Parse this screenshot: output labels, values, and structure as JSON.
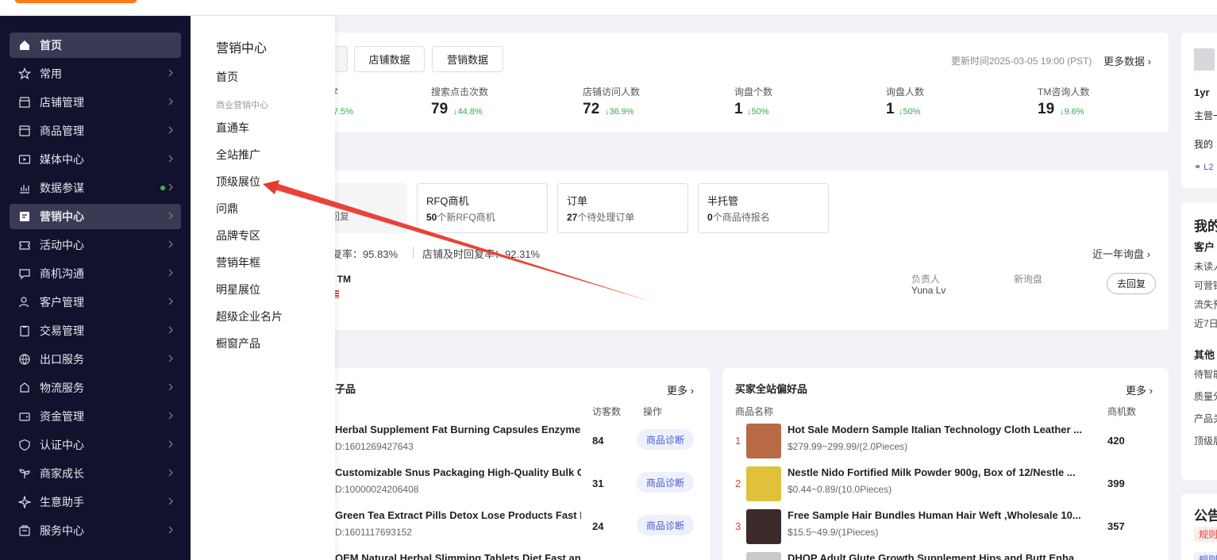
{
  "nav": [
    {
      "label": "首页",
      "icon": "home-icon"
    },
    {
      "label": "常用",
      "icon": "star-icon"
    },
    {
      "label": "店铺管理",
      "icon": "store-icon"
    },
    {
      "label": "商品管理",
      "icon": "box-icon"
    },
    {
      "label": "媒体中心",
      "icon": "video-icon"
    },
    {
      "label": "数据参谋",
      "icon": "chart-icon"
    },
    {
      "label": "营销中心",
      "icon": "marketing-icon"
    },
    {
      "label": "活动中心",
      "icon": "ticket-icon"
    },
    {
      "label": "商机沟通",
      "icon": "message-icon"
    },
    {
      "label": "客户管理",
      "icon": "users-icon"
    },
    {
      "label": "交易管理",
      "icon": "clipboard-icon"
    },
    {
      "label": "出口服务",
      "icon": "globe-icon"
    },
    {
      "label": "物流服务",
      "icon": "truck-icon"
    },
    {
      "label": "资金管理",
      "icon": "wallet-icon"
    },
    {
      "label": "认证中心",
      "icon": "shield-icon"
    },
    {
      "label": "商家成长",
      "icon": "sprout-icon"
    },
    {
      "label": "生意助手",
      "icon": "sparkle-icon"
    },
    {
      "label": "服务中心",
      "icon": "service-icon"
    }
  ],
  "flyout": {
    "title": "营销中心",
    "home": "首页",
    "section": "商业营销中心",
    "items": [
      "直通车",
      "全站推广",
      "顶级展位",
      "问鼎",
      "品牌专区",
      "营销年框",
      "明星展位",
      "超级企业名片",
      "橱窗产品"
    ]
  },
  "stats_card": {
    "tabs": [
      "店铺数据",
      "营销数据"
    ],
    "updated": "更新时间2025-03-05 19:00 (PST)",
    "more": "更多数据",
    "partial_change": "7.5%",
    "stats": [
      {
        "label": "搜索点击次数",
        "value": "79",
        "change": "↓44.8%"
      },
      {
        "label": "店铺访问人数",
        "value": "72",
        "change": "↓36.9%"
      },
      {
        "label": "询盘个数",
        "value": "1",
        "change": "↓50%"
      },
      {
        "label": "询盘人数",
        "value": "1",
        "change": "↓50%"
      },
      {
        "label": "TM咨询人数",
        "value": "19",
        "change": "↓9.6%"
      }
    ]
  },
  "inquiry_card": {
    "partial_box_text": "回复",
    "boxes": [
      {
        "title": "RFQ商机",
        "count": "50",
        "text": "个新RFQ商机"
      },
      {
        "title": "订单",
        "count": "27",
        "text": "个待处理订单"
      },
      {
        "title": "半托管",
        "count": "0",
        "text": "个商品待报名"
      }
    ],
    "rate1": "复率：95.83%",
    "rate2": "店铺及时回复率：92.31%",
    "year_link": "近一年询盘",
    "tm_label": "TM",
    "owner_label": "负责人",
    "owner_name": "Yuna Lv",
    "new_inquiry": "新询盘",
    "reply_button": "去回复"
  },
  "left_products": {
    "title": "子品",
    "more": "更多",
    "col_visitors": "访客数",
    "col_action": "操作",
    "rows": [
      {
        "title": "Herbal Supplement Fat Burning Capsules Enzyme ...",
        "id": "D:1601269427643",
        "visitors": "84",
        "action": "商品诊断"
      },
      {
        "title": "Customizable Snus Packaging High-Quality Bulk Or...",
        "id": "D:10000024206408",
        "visitors": "31",
        "action": "商品诊断"
      },
      {
        "title": "Green Tea Extract Pills Detox Lose Products Fast B...",
        "id": "D:1601117693152",
        "visitors": "24",
        "action": "商品诊断"
      },
      {
        "title": "OEM Natural Herbal Slimming Tablets Diet Fast an...",
        "id": "",
        "visitors": "",
        "action": ""
      }
    ]
  },
  "right_products": {
    "title": "买家全站偏好品",
    "more": "更多",
    "col_name": "商品名称",
    "col_count": "商机数",
    "rows": [
      {
        "rank": "1",
        "title": "Hot Sale Modern Sample Italian Technology Cloth Leather ...",
        "price": "$279.99~299.99/(2.0Pieces)",
        "count": "420",
        "thumb": "#b86a45"
      },
      {
        "rank": "2",
        "title": "Nestle Nido Fortified Milk Powder 900g, Box of 12/Nestle ...",
        "price": "$0.44~0.89/(10.0Pieces)",
        "count": "399",
        "thumb": "#e0c23a"
      },
      {
        "rank": "3",
        "title": "Free Sample Hair Bundles Human Hair Weft ,Wholesale 10...",
        "price": "$15.5~49.9/(1Pieces)",
        "count": "357",
        "thumb": "#3a2a2a"
      },
      {
        "rank": "",
        "title": "DHOP Adult Glute Growth Supplement Hips and Butt Enha...",
        "price": "",
        "count": "",
        "thumb": "#c9c9c9"
      }
    ]
  },
  "right_panel": {
    "store_year": "1yr",
    "main_label": "主营一",
    "mine_label": "我的",
    "level": "L2",
    "my_title": "我的",
    "customers": "客户",
    "lines": [
      "未读人",
      "可营销",
      "流失预",
      "近7日"
    ],
    "other": "其他",
    "other_lines": [
      "待智能",
      "质量分",
      "产品关",
      "顶级展"
    ],
    "notice_title": "公告",
    "notice_tag": "规则",
    "notice_tag2": "规则"
  },
  "colors": {
    "sidebar_bg": "#12122e",
    "active_bg": "#3a3a55",
    "accent": "#ff6a00",
    "green": "#2fae4b",
    "arrow": "#e8392e"
  }
}
